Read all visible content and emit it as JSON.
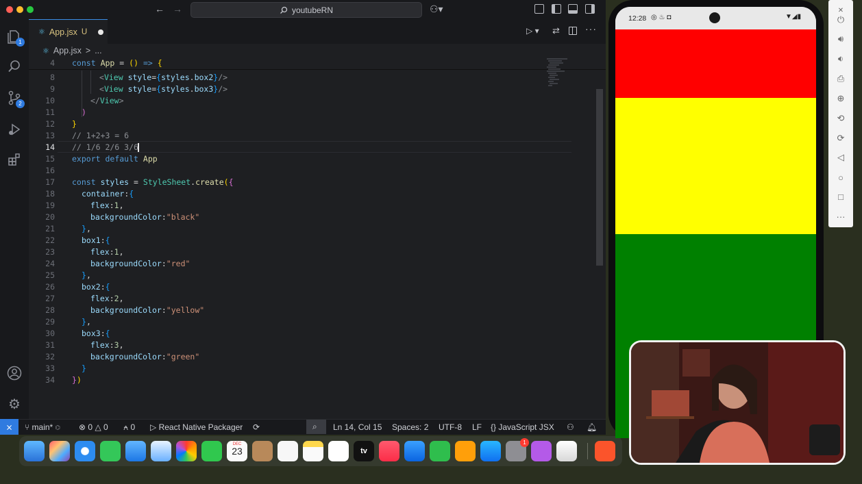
{
  "window": {
    "search_text": "youtubeRN"
  },
  "activity_badges": {
    "explorer": "1",
    "scm": "2"
  },
  "tab": {
    "filename": "App.jsx",
    "status": "U"
  },
  "breadcrumb": {
    "file": "App.jsx",
    "sep": ">",
    "rest": "..."
  },
  "code_lines": [
    {
      "num": "4",
      "text": "const App = () => {"
    },
    {
      "num": "8",
      "text": "<View style={styles.box2}/>"
    },
    {
      "num": "9",
      "text": "<View style={styles.box3}/>"
    },
    {
      "num": "10",
      "text": "</View>"
    },
    {
      "num": "11",
      "text": ")"
    },
    {
      "num": "12",
      "text": "}"
    },
    {
      "num": "13",
      "text": "// 1+2+3 = 6"
    },
    {
      "num": "14",
      "text": "// 1/6 2/6 3/6"
    },
    {
      "num": "15",
      "text": "export default App"
    },
    {
      "num": "16",
      "text": ""
    },
    {
      "num": "17",
      "text": "const styles = StyleSheet.create({"
    },
    {
      "num": "18",
      "text": "container:{"
    },
    {
      "num": "19",
      "text": "flex:1,"
    },
    {
      "num": "20",
      "text": "backgroundColor:\"black\""
    },
    {
      "num": "21",
      "text": "},"
    },
    {
      "num": "22",
      "text": "box1:{"
    },
    {
      "num": "23",
      "text": "flex:1,"
    },
    {
      "num": "24",
      "text": "backgroundColor:\"red\""
    },
    {
      "num": "25",
      "text": "},"
    },
    {
      "num": "26",
      "text": "box2:{"
    },
    {
      "num": "27",
      "text": "flex:2,"
    },
    {
      "num": "28",
      "text": "backgroundColor:\"yellow\""
    },
    {
      "num": "29",
      "text": "},"
    },
    {
      "num": "30",
      "text": "box3:{"
    },
    {
      "num": "31",
      "text": "flex:3,"
    },
    {
      "num": "32",
      "text": "backgroundColor:\"green\""
    },
    {
      "num": "33",
      "text": "}"
    },
    {
      "num": "34",
      "text": "})"
    }
  ],
  "status_bar": {
    "branch": "main*",
    "errors": "0",
    "warnings": "0",
    "ports": "0",
    "packager": "React Native Packager",
    "position": "Ln 14, Col 15",
    "spaces": "Spaces: 2",
    "encoding": "UTF-8",
    "eol": "LF",
    "language": "JavaScript JSX"
  },
  "dock": {
    "calendar_month": "DEC",
    "calendar_day": "23",
    "appletv_label": "tv",
    "app_store_badge": "1"
  },
  "phone": {
    "time": "12:28",
    "boxes": [
      {
        "name": "box1",
        "color": "#ff0000",
        "flex": 1
      },
      {
        "name": "box2",
        "color": "#ffff00",
        "flex": 2
      },
      {
        "name": "box3",
        "color": "#008000",
        "flex": 3
      }
    ]
  },
  "colors": {
    "accent": "#3a8ee6",
    "editor_bg": "#1e1f22",
    "statusbar_remote": "#2f7be0"
  }
}
